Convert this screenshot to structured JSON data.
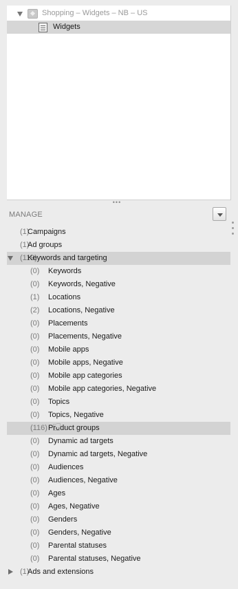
{
  "tree": {
    "campaign": {
      "label": "Shopping – Widgets – NB – US",
      "icon": "shopping-campaign-icon"
    },
    "ad_group": {
      "label": "Widgets",
      "icon": "ad-group-icon"
    }
  },
  "manage": {
    "title": "MANAGE",
    "items": [
      {
        "label": "Campaigns",
        "count": "(1)"
      },
      {
        "label": "Ad groups",
        "count": "(1)"
      },
      {
        "label": "Keywords and targeting",
        "count": "(119)"
      },
      {
        "label": "Keywords",
        "count": "(0)"
      },
      {
        "label": "Keywords, Negative",
        "count": "(0)"
      },
      {
        "label": "Locations",
        "count": "(1)"
      },
      {
        "label": "Locations, Negative",
        "count": "(2)"
      },
      {
        "label": "Placements",
        "count": "(0)"
      },
      {
        "label": "Placements, Negative",
        "count": "(0)"
      },
      {
        "label": "Mobile apps",
        "count": "(0)"
      },
      {
        "label": "Mobile apps, Negative",
        "count": "(0)"
      },
      {
        "label": "Mobile app categories",
        "count": "(0)"
      },
      {
        "label": "Mobile app categories, Negative",
        "count": "(0)"
      },
      {
        "label": "Topics",
        "count": "(0)"
      },
      {
        "label": "Topics, Negative",
        "count": "(0)"
      },
      {
        "label": "Product groups",
        "count": "(116)"
      },
      {
        "label": "Dynamic ad targets",
        "count": "(0)"
      },
      {
        "label": "Dynamic ad targets, Negative",
        "count": "(0)"
      },
      {
        "label": "Audiences",
        "count": "(0)"
      },
      {
        "label": "Audiences, Negative",
        "count": "(0)"
      },
      {
        "label": "Ages",
        "count": "(0)"
      },
      {
        "label": "Ages, Negative",
        "count": "(0)"
      },
      {
        "label": "Genders",
        "count": "(0)"
      },
      {
        "label": "Genders, Negative",
        "count": "(0)"
      },
      {
        "label": "Parental statuses",
        "count": "(0)"
      },
      {
        "label": "Parental statuses, Negative",
        "count": "(0)"
      },
      {
        "label": "Ads and extensions",
        "count": "(1)"
      }
    ]
  },
  "colors": {
    "selected_row": "#d3d3d3",
    "panel_bg": "#ececec",
    "count_text": "#7a7a7a"
  }
}
